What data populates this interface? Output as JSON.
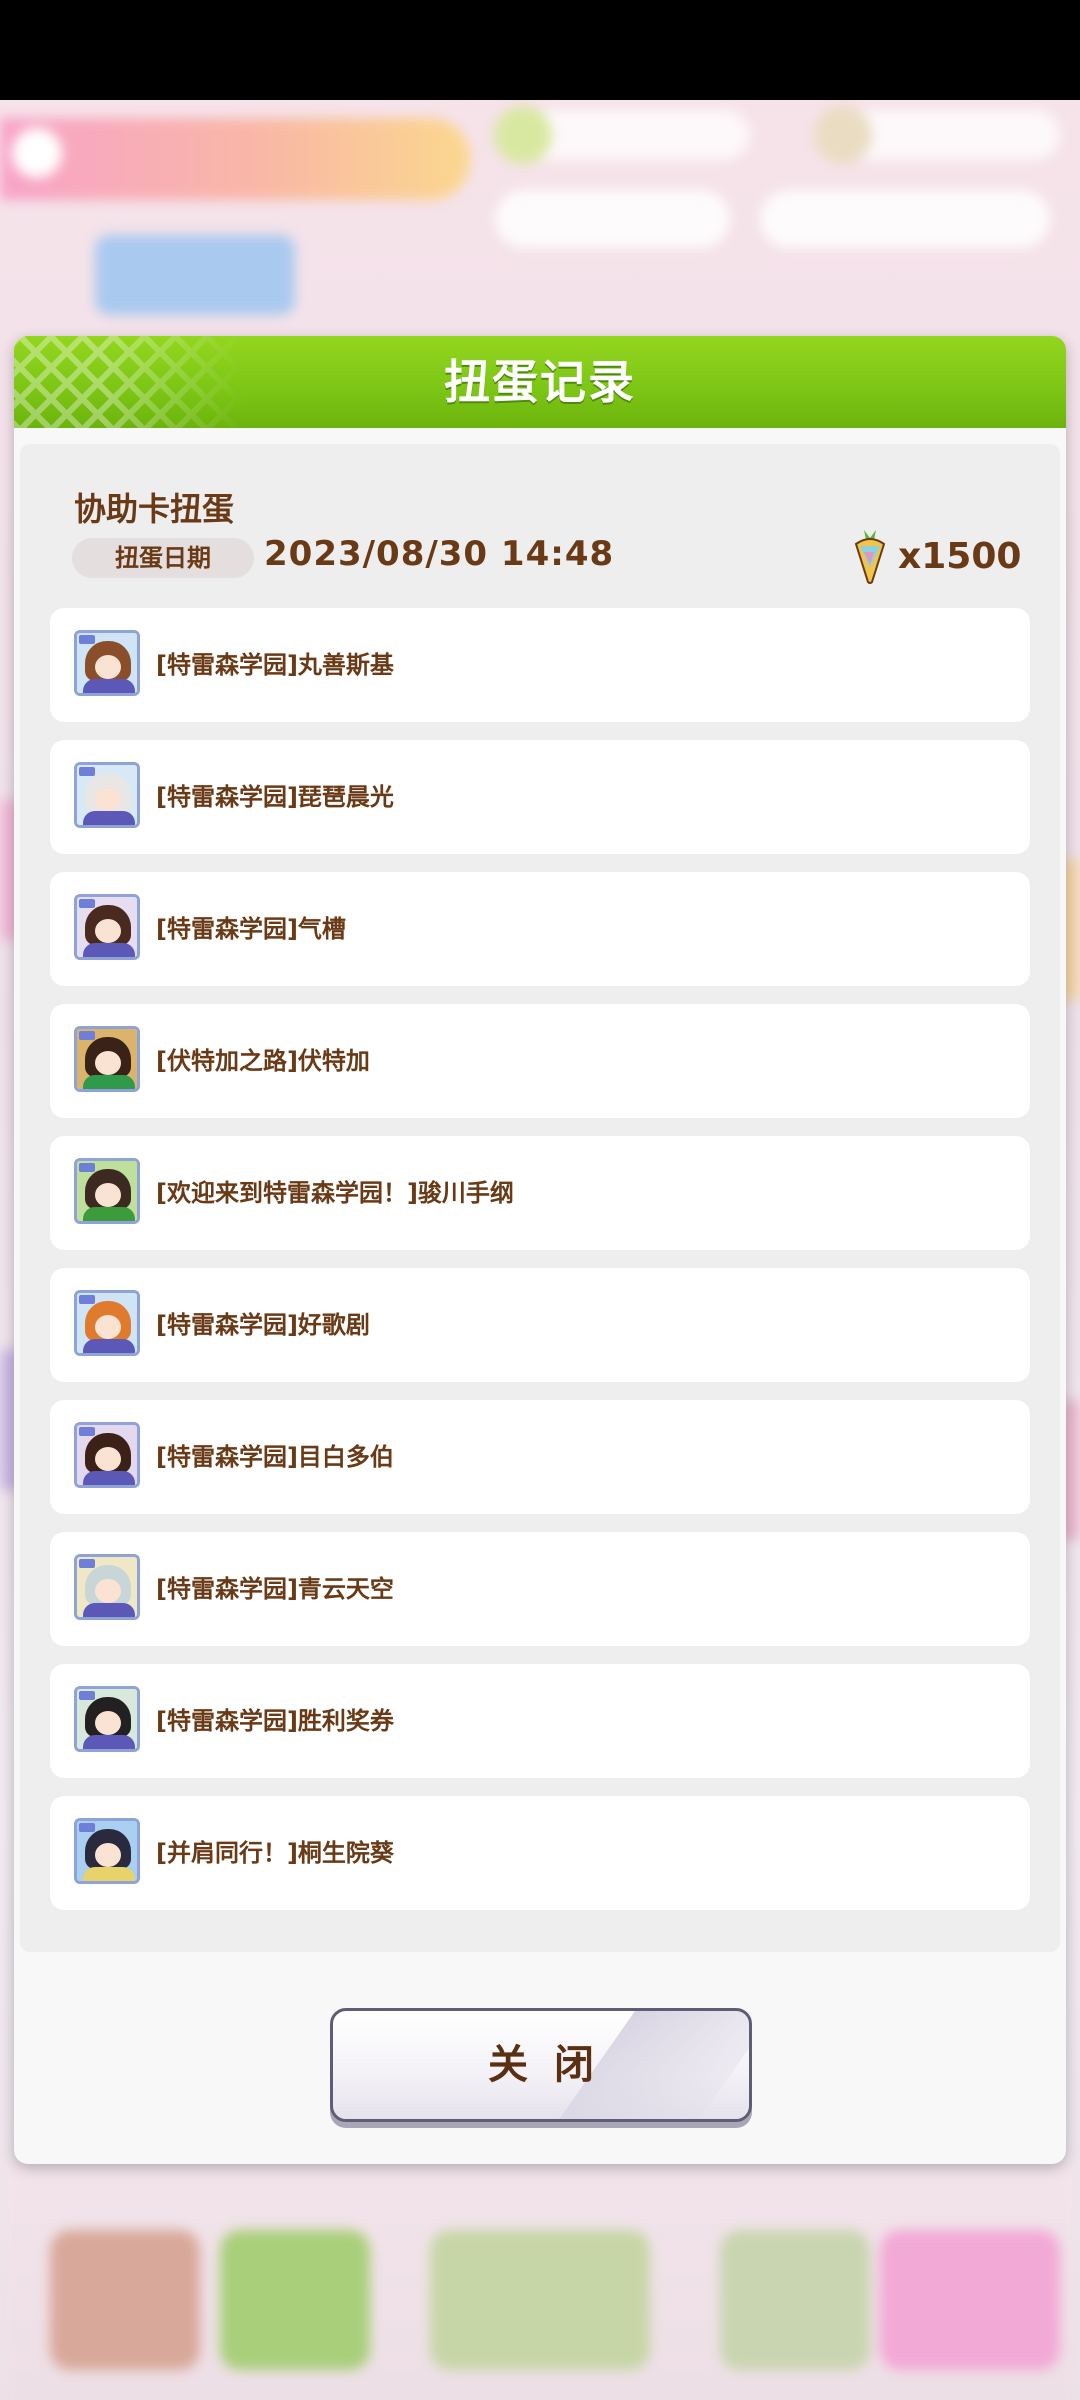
{
  "dialog": {
    "title": "扭蛋记录",
    "section_title": "协助卡扭蛋",
    "date_label": "扭蛋日期",
    "date_value": "2023/08/30  14:48",
    "cost": "x1500",
    "cost_icon": "carrot-jewel-icon",
    "close_label": "关闭"
  },
  "results": [
    {
      "name": "[特雷森学园]丸善斯基",
      "hair": "#8a4f2a",
      "outfit": "#5b58b8",
      "bg": "#cfe4f4"
    },
    {
      "name": "[特雷森学园]琵琶晨光",
      "hair": "#e9e6e6",
      "outfit": "#5b58b8",
      "bg": "#d6e9f5"
    },
    {
      "name": "[特雷森学园]气槽",
      "hair": "#4a2a1e",
      "outfit": "#5b58b8",
      "bg": "#e6def0"
    },
    {
      "name": "[伏特加之路]伏特加",
      "hair": "#3a2218",
      "outfit": "#2f9a4b",
      "bg": "#d9b46a"
    },
    {
      "name": "[欢迎来到特雷森学园！]骏川手纲",
      "hair": "#3c2a22",
      "outfit": "#3c9b3a",
      "bg": "#bfe09c"
    },
    {
      "name": "[特雷森学园]好歌剧",
      "hair": "#e07a2c",
      "outfit": "#5b58b8",
      "bg": "#cfe4f4"
    },
    {
      "name": "[特雷森学园]目白多伯",
      "hair": "#3b2118",
      "outfit": "#5b58b8",
      "bg": "#e4d8ef"
    },
    {
      "name": "[特雷森学园]青云天空",
      "hair": "#c9d6d8",
      "outfit": "#5b58b8",
      "bg": "#f0e8c4"
    },
    {
      "name": "[特雷森学园]胜利奖券",
      "hair": "#232022",
      "outfit": "#5b58b8",
      "bg": "#d8e9dc"
    },
    {
      "name": "[并肩同行！]桐生院葵",
      "hair": "#2a2a3e",
      "outfit": "#e8d26a",
      "bg": "#aacff0"
    }
  ]
}
